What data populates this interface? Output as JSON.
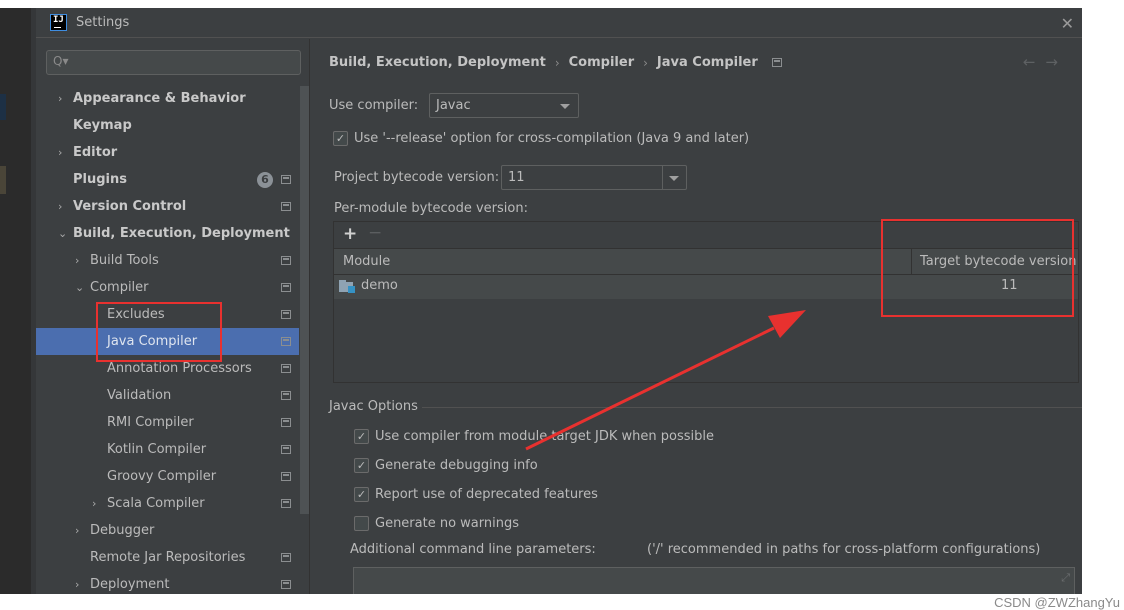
{
  "window": {
    "title": "Settings",
    "app_icon_text": "IJ",
    "close_glyph": "✕"
  },
  "sidebar": {
    "search_placeholder": "",
    "search_glyph": "Q▾",
    "items": [
      {
        "label": "Appearance & Behavior",
        "chevron": "›",
        "level": 0,
        "bold": true,
        "proj_icon": false
      },
      {
        "label": "Keymap",
        "chevron": "",
        "level": 0,
        "bold": true,
        "proj_icon": false
      },
      {
        "label": "Editor",
        "chevron": "›",
        "level": 0,
        "bold": true,
        "proj_icon": false
      },
      {
        "label": "Plugins",
        "chevron": "",
        "level": 0,
        "bold": true,
        "proj_icon": true,
        "badge": "6"
      },
      {
        "label": "Version Control",
        "chevron": "›",
        "level": 0,
        "bold": true,
        "proj_icon": true
      },
      {
        "label": "Build, Execution, Deployment",
        "chevron": "⌄",
        "level": 0,
        "bold": true,
        "proj_icon": false
      },
      {
        "label": "Build Tools",
        "chevron": "›",
        "level": 1,
        "bold": false,
        "proj_icon": true
      },
      {
        "label": "Compiler",
        "chevron": "⌄",
        "level": 1,
        "bold": false,
        "proj_icon": true
      },
      {
        "label": "Excludes",
        "chevron": "",
        "level": 2,
        "bold": false,
        "proj_icon": true
      },
      {
        "label": "Java Compiler",
        "chevron": "",
        "level": 2,
        "bold": false,
        "proj_icon": true,
        "selected": true
      },
      {
        "label": "Annotation Processors",
        "chevron": "",
        "level": 2,
        "bold": false,
        "proj_icon": true
      },
      {
        "label": "Validation",
        "chevron": "",
        "level": 2,
        "bold": false,
        "proj_icon": true
      },
      {
        "label": "RMI Compiler",
        "chevron": "",
        "level": 2,
        "bold": false,
        "proj_icon": true
      },
      {
        "label": "Kotlin Compiler",
        "chevron": "",
        "level": 2,
        "bold": false,
        "proj_icon": true
      },
      {
        "label": "Groovy Compiler",
        "chevron": "",
        "level": 2,
        "bold": false,
        "proj_icon": true
      },
      {
        "label": "Scala Compiler",
        "chevron": "›",
        "level": 2,
        "bold": false,
        "proj_icon": true
      },
      {
        "label": "Debugger",
        "chevron": "›",
        "level": 1,
        "bold": false,
        "proj_icon": false
      },
      {
        "label": "Remote Jar Repositories",
        "chevron": "",
        "level": 1,
        "bold": false,
        "proj_icon": true
      },
      {
        "label": "Deployment",
        "chevron": "›",
        "level": 1,
        "bold": false,
        "proj_icon": true
      }
    ]
  },
  "content": {
    "breadcrumb": [
      "Build, Execution, Deployment",
      "Compiler",
      "Java Compiler"
    ],
    "breadcrumb_sep": "›",
    "nav_back": "←",
    "nav_forward": "→",
    "use_compiler_label": "Use compiler:",
    "use_compiler_value": "Javac",
    "release_option": {
      "label": "Use '--release' option for cross-compilation (Java 9 and later)",
      "checked": true
    },
    "project_bytecode_label": "Project bytecode version:",
    "project_bytecode_value": "11",
    "per_module_label": "Per-module bytecode version:",
    "table": {
      "add_glyph": "+",
      "remove_glyph": "−",
      "columns": [
        "Module",
        "Target bytecode version"
      ],
      "rows": [
        {
          "module": "demo",
          "target": "11"
        }
      ]
    },
    "javac_options_title": "Javac Options",
    "javac_options": [
      {
        "label": "Use compiler from module target JDK when possible",
        "checked": true
      },
      {
        "label": "Generate debugging info",
        "checked": true
      },
      {
        "label": "Report use of deprecated features",
        "checked": true
      },
      {
        "label": "Generate no warnings",
        "checked": false
      }
    ],
    "additional_params_label": "Additional command line parameters:",
    "additional_params_hint": "('/' recommended in paths for cross-platform configurations)",
    "additional_params_value": "",
    "expand_glyph": "⤢"
  },
  "annotations": {
    "color": "#e8312f"
  },
  "watermark": "CSDN @ZWZhangYu"
}
